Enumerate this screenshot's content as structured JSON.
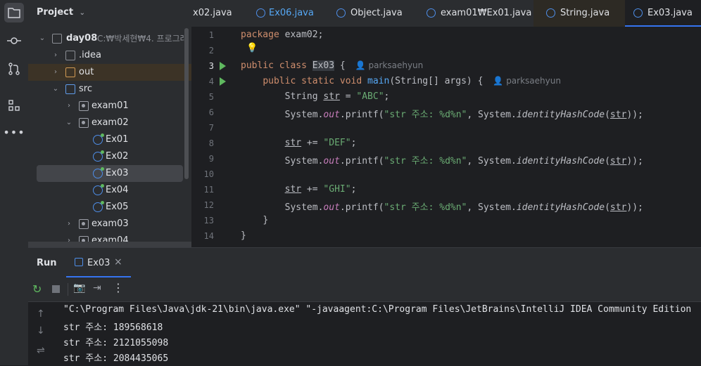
{
  "project": {
    "title": "Project",
    "tree": [
      {
        "label": "day08",
        "path": "C:₩박세현₩4. 프로그래",
        "kind": "folder-root"
      },
      {
        "label": ".idea",
        "kind": "folder"
      },
      {
        "label": "out",
        "kind": "folder-orange"
      },
      {
        "label": "src",
        "kind": "folder-blue"
      },
      {
        "label": "exam01",
        "kind": "package"
      },
      {
        "label": "exam02",
        "kind": "package"
      },
      {
        "label": "Ex01",
        "kind": "class"
      },
      {
        "label": "Ex02",
        "kind": "class"
      },
      {
        "label": "Ex03",
        "kind": "class"
      },
      {
        "label": "Ex04",
        "kind": "class"
      },
      {
        "label": "Ex05",
        "kind": "class"
      },
      {
        "label": "exam03",
        "kind": "package"
      },
      {
        "label": "exam04",
        "kind": "package"
      }
    ]
  },
  "tabs": [
    {
      "label": "x02.java"
    },
    {
      "label": "Ex06.java"
    },
    {
      "label": "Object.java"
    },
    {
      "label": "exam01₩Ex01.java"
    },
    {
      "label": "String.java"
    },
    {
      "label": "Ex03.java"
    }
  ],
  "editor": {
    "line_numbers": [
      "1",
      "2",
      "3",
      "4",
      "5",
      "6",
      "7",
      "8",
      "9",
      "10",
      "11",
      "12",
      "13",
      "14"
    ],
    "author_hint": "parksaehyun",
    "code": {
      "l1_kw": "package",
      "l1_rest": " exam02;",
      "l3_kw": "public class",
      "l3_cls": "Ex03",
      "l3_brace": " {",
      "l4_kw": "public static void",
      "l4_mth": "main",
      "l4_rest": "(String[] args) {",
      "l5_type": "String ",
      "l5_var": "str",
      "l5_eq": " = ",
      "l5_str": "\"ABC\"",
      "l5_end": ";",
      "print_sys": "System.",
      "print_out": "out",
      "print_fn": ".printf(",
      "print_fmt": "\"str 주소: %d%n\"",
      "print_mid": ", System.",
      "print_ihc": "identityHashCode",
      "print_open": "(",
      "print_var": "str",
      "print_close": "));",
      "l8_var": "str",
      "l8_op": " += ",
      "l8_str": "\"DEF\"",
      "l8_end": ";",
      "l11_var": "str",
      "l11_op": " += ",
      "l11_str": "\"GHI\"",
      "l11_end": ";",
      "l13": "}",
      "l14": "}"
    }
  },
  "run": {
    "title": "Run",
    "tab_label": "Ex03",
    "output": [
      "\"C:\\Program Files\\Java\\jdk-21\\bin\\java.exe\" \"-javaagent:C:\\Program Files\\JetBrains\\IntelliJ IDEA Community Edition",
      "str 주소: 189568618",
      "str 주소: 2121055098",
      "str 주소: 2084435065"
    ]
  },
  "colors": {
    "accent": "#3574f0",
    "keyword": "#cf8e6d",
    "string": "#6aab73",
    "method": "#56a8f5",
    "field": "#c77dbb"
  }
}
